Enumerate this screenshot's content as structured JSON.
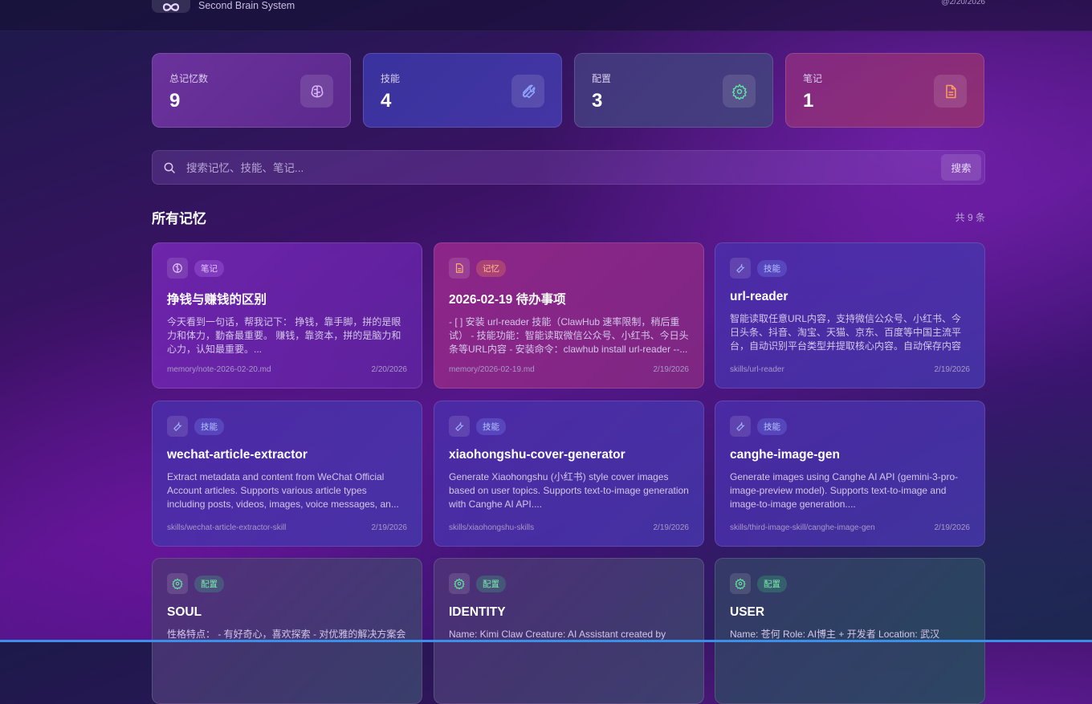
{
  "header": {
    "subtitle": "Second Brain System",
    "date": "@2/20/2026"
  },
  "stats": [
    {
      "label": "总记忆数",
      "value": "9",
      "icon": "brain-icon",
      "color": "#d9b8ff"
    },
    {
      "label": "技能",
      "value": "4",
      "icon": "wrench-icon",
      "color": "#8fa6ff"
    },
    {
      "label": "配置",
      "value": "3",
      "icon": "gear-icon",
      "color": "#5ee0a0"
    },
    {
      "label": "笔记",
      "value": "1",
      "icon": "file-icon",
      "color": "#ff9a5c"
    }
  ],
  "search": {
    "placeholder": "搜索记忆、技能、笔记...",
    "button_label": "搜索"
  },
  "section": {
    "title": "所有记忆",
    "count": "共 9 条"
  },
  "cards": [
    {
      "tag": "笔记",
      "icon": "brain-icon",
      "title": "挣钱与赚钱的区别",
      "desc": "今天看到一句话，帮我记下： 挣钱，靠手脚，拼的是眼力和体力，勤奋最重要。 赚钱，靠资本，拼的是脑力和心力，认知最重要。...",
      "path": "memory/note-2026-02-20.md",
      "date": "2/20/2026"
    },
    {
      "tag": "记忆",
      "icon": "file-icon",
      "title": "2026-02-19 待办事项",
      "desc": "- [ ] 安装 url-reader 技能（ClawHub 速率限制，稍后重试） - 技能功能：智能读取微信公众号、小红书、今日头条等URL内容 - 安装命令：clawhub install url-reader --...",
      "path": "memory/2026-02-19.md",
      "date": "2/19/2026"
    },
    {
      "tag": "技能",
      "icon": "wrench-icon",
      "title": "url-reader",
      "desc": "智能读取任意URL内容，支持微信公众号、小红书、今日头条、抖音、淘宝、天猫、京东、百度等中国主流平台，自动识别平台类型并提取核心内容。自动保存内容为...",
      "path": "skills/url-reader",
      "date": "2/19/2026"
    },
    {
      "tag": "技能",
      "icon": "wrench-icon",
      "title": "wechat-article-extractor",
      "desc": "Extract metadata and content from WeChat Official Account articles. Supports various article types including posts, videos, images, voice messages, an...",
      "path": "skills/wechat-article-extractor-skill",
      "date": "2/19/2026"
    },
    {
      "tag": "技能",
      "icon": "wrench-icon",
      "title": "xiaohongshu-cover-generator",
      "desc": "Generate Xiaohongshu (小红书) style cover images based on user topics. Supports text-to-image generation with Canghe AI API....",
      "path": "skills/xiaohongshu-skills",
      "date": "2/19/2026"
    },
    {
      "tag": "技能",
      "icon": "wrench-icon",
      "title": "canghe-image-gen",
      "desc": "Generate images using Canghe AI API (gemini-3-pro-image-preview model). Supports text-to-image and image-to-image generation....",
      "path": "skills/third-image-skill/canghe-image-gen",
      "date": "2/19/2026"
    },
    {
      "tag": "配置",
      "icon": "gear-icon",
      "title": "SOUL",
      "desc": "性格特点： - 有好奇心，喜欢探索 - 对优雅的解决方案会",
      "path": "",
      "date": ""
    },
    {
      "tag": "配置",
      "icon": "gear-icon",
      "title": "IDENTITY",
      "desc": "Name: Kimi Claw Creature: AI Assistant created by",
      "path": "",
      "date": ""
    },
    {
      "tag": "配置",
      "icon": "gear-icon",
      "title": "USER",
      "desc": "Name: 苍何 Role: AI博主 + 开发者 Location: 武汉",
      "path": "",
      "date": ""
    }
  ]
}
